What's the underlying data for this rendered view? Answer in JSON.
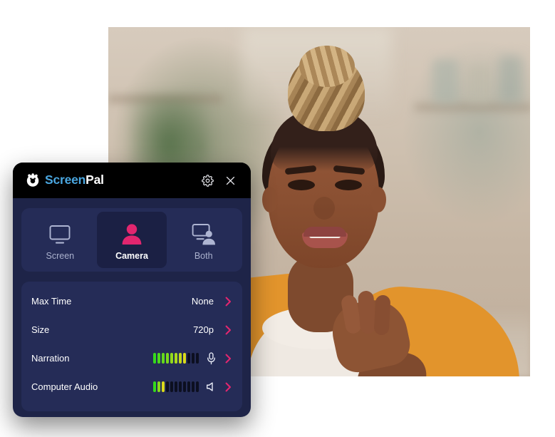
{
  "video_preview": {
    "name": "camera-preview",
    "description": "Webcam preview of a smiling person in a mustard jacket in a blurred kitchen"
  },
  "recorder": {
    "header": {
      "logo_icon": "screenpal-logo-icon",
      "brand_part1": "Screen",
      "brand_part2": "Pal",
      "settings_icon": "gear-icon",
      "close_icon": "close-icon"
    },
    "mode_tabs": [
      {
        "id": "screen",
        "label": "Screen",
        "icon": "monitor-icon",
        "active": false
      },
      {
        "id": "camera",
        "label": "Camera",
        "icon": "person-icon",
        "active": true
      },
      {
        "id": "both",
        "label": "Both",
        "icon": "monitor-person-icon",
        "active": false
      }
    ],
    "settings": [
      {
        "id": "max-time",
        "label": "Max Time",
        "value": "None",
        "type": "value",
        "chevron": "chevron-right-icon"
      },
      {
        "id": "size",
        "label": "Size",
        "value": "720p",
        "type": "value",
        "chevron": "chevron-right-icon"
      },
      {
        "id": "narration",
        "label": "Narration",
        "type": "meter",
        "icon": "microphone-icon",
        "meter_total": 11,
        "meter_level": 8,
        "chevron": "chevron-right-icon"
      },
      {
        "id": "computer-audio",
        "label": "Computer Audio",
        "type": "meter",
        "icon": "speaker-icon",
        "meter_total": 11,
        "meter_level": 3,
        "chevron": "chevron-right-icon"
      }
    ]
  },
  "colors": {
    "panel_bg": "#1e2448",
    "card_bg": "#252c57",
    "active_tab_bg": "#1b2044",
    "header_bg": "#000000",
    "accent_pink": "#e2266f",
    "brand_blue": "#4aa6df",
    "meter_off": "#0c0f20",
    "text_primary": "#ffffff",
    "text_muted": "#aab1cd"
  }
}
